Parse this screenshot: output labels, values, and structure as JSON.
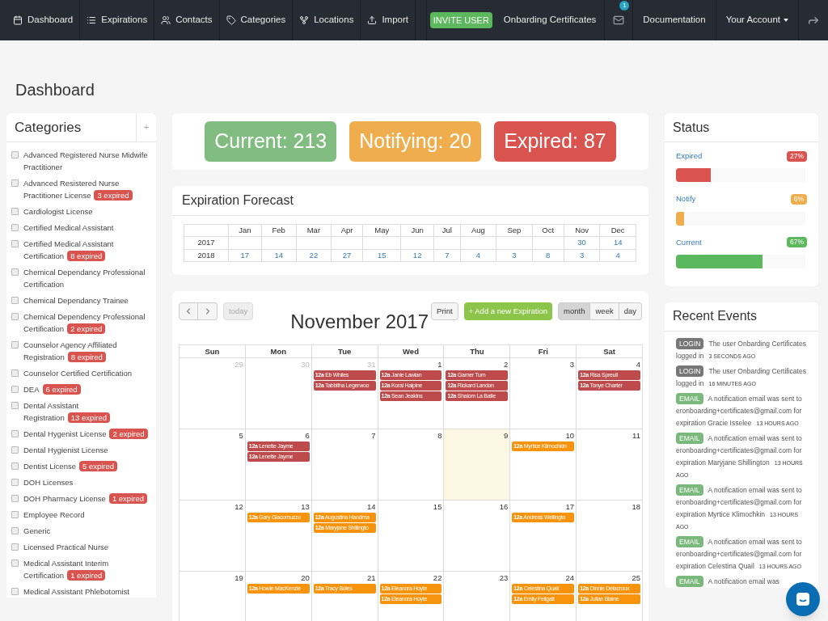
{
  "nav": {
    "items": [
      {
        "label": "Dashboard"
      },
      {
        "label": "Expirations"
      },
      {
        "label": "Contacts"
      },
      {
        "label": "Categories"
      },
      {
        "label": "Locations"
      },
      {
        "label": "Import"
      }
    ],
    "invite": "INVITE USER",
    "user": "Onbarding Certificates",
    "mail_count": "1",
    "documentation": "Documentation",
    "account": "Your Account"
  },
  "page_title": "Dashboard",
  "categories": {
    "title": "Categories",
    "add": "+",
    "items": [
      {
        "label": "Advanced Registered Nurse Midwife Practitioner",
        "checked": false
      },
      {
        "label": "Advanced Resistered Nurse Practitioner License",
        "badge": "3 expired",
        "checked": false
      },
      {
        "label": "Cardiologist License",
        "checked": false
      },
      {
        "label": "Certified Medical Assistant",
        "checked": false
      },
      {
        "label": "Certified Medical Assistant Certification",
        "badge": "8 expired",
        "checked": false
      },
      {
        "label": "Chemical Dependancy Professional Certification",
        "checked": false
      },
      {
        "label": "Chemical Dependancy Trainee",
        "checked": false
      },
      {
        "label": "Chemical Dependency Professional Certification",
        "badge": "2 expired",
        "checked": false
      },
      {
        "label": "Counselor Agency Affiliated Registration",
        "badge": "8 expired",
        "checked": false
      },
      {
        "label": "Counselor Certified Certification",
        "checked": false
      },
      {
        "label": "DEA",
        "badge": "6 expired",
        "checked": false
      },
      {
        "label": "Dental Assistant Registration",
        "badge": "13 expired",
        "checked": false
      },
      {
        "label": "Dental Hygenist License",
        "badge": "2 expired",
        "checked": false
      },
      {
        "label": "Dental Hygienist License",
        "checked": false
      },
      {
        "label": "Dentist License",
        "badge": "5 expired",
        "checked": false
      },
      {
        "label": "DOH Licenses",
        "checked": false
      },
      {
        "label": "DOH Pharmacy License",
        "badge": "1 expired",
        "checked": false
      },
      {
        "label": "Employee Record",
        "checked": false
      },
      {
        "label": "Generic",
        "checked": false
      },
      {
        "label": "Licensed Practical Nurse",
        "checked": false
      },
      {
        "label": "Medical Assistant Interim Certification",
        "badge": "1 expired",
        "checked": false
      },
      {
        "label": "Medical Assistant Phlebotomist",
        "checked": false
      }
    ]
  },
  "summary": [
    {
      "kind": "current",
      "label": "Current: 213"
    },
    {
      "kind": "notifying",
      "label": "Notifying: 20"
    },
    {
      "kind": "expired",
      "label": "Expired: 87"
    }
  ],
  "forecast": {
    "title": "Expiration Forecast",
    "months": [
      "Jan",
      "Feb",
      "Mar",
      "Apr",
      "May",
      "Jun",
      "Jul",
      "Aug",
      "Sep",
      "Oct",
      "Nov",
      "Dec"
    ],
    "rows": [
      {
        "year": "2017",
        "cells": [
          null,
          null,
          null,
          null,
          null,
          null,
          null,
          null,
          null,
          null,
          "30",
          "14"
        ]
      },
      {
        "year": "2018",
        "cells": [
          "17",
          "14",
          "22",
          "27",
          "15",
          "12",
          "7",
          "4",
          "3",
          "8",
          "3",
          "4"
        ]
      }
    ]
  },
  "calendar": {
    "title": "November 2017",
    "today_button": "today",
    "print": "Print",
    "add": "+ Add a new Expiration",
    "views": [
      {
        "label": "month",
        "selected": true
      },
      {
        "label": "week",
        "selected": false
      },
      {
        "label": "day",
        "selected": false
      }
    ],
    "weekdays": [
      "Sun",
      "Mon",
      "Tue",
      "Wed",
      "Thu",
      "Fri",
      "Sat"
    ],
    "weeks": [
      [
        {
          "day": "29",
          "other_month": true,
          "today": false
        },
        {
          "day": "30",
          "other_month": true,
          "today": false
        },
        {
          "day": "31",
          "other_month": true,
          "today": false,
          "events": [
            {
              "time": "12a",
              "name": "Eb Whiles",
              "color": "#bd4b4b"
            },
            {
              "time": "12a",
              "name": "Tabbitha Legerwoo",
              "color": "#bd4b4b"
            }
          ]
        },
        {
          "day": "1",
          "other_month": false,
          "today": false,
          "events": [
            {
              "time": "12a",
              "name": "Janie Lawlan",
              "color": "#bd4b4b"
            },
            {
              "time": "12a",
              "name": "Koral Halpine",
              "color": "#bd4b4b"
            },
            {
              "time": "12a",
              "name": "Sean Jeakins",
              "color": "#bd4b4b"
            }
          ]
        },
        {
          "day": "2",
          "other_month": false,
          "today": false,
          "events": [
            {
              "time": "12a",
              "name": "Garner Turn",
              "color": "#bd4b4b"
            },
            {
              "time": "12a",
              "name": "Rickard Landon",
              "color": "#bd4b4b"
            },
            {
              "time": "12a",
              "name": "Shalom La Batie",
              "color": "#bd4b4b"
            }
          ]
        },
        {
          "day": "3",
          "other_month": false,
          "today": false
        },
        {
          "day": "4",
          "other_month": false,
          "today": false,
          "events": [
            {
              "time": "12a",
              "name": "Risa Spreull",
              "color": "#bd4b4b"
            },
            {
              "time": "12a",
              "name": "Tonye Charter",
              "color": "#bd4b4b"
            }
          ]
        }
      ],
      [
        {
          "day": "5",
          "other_month": false,
          "today": false
        },
        {
          "day": "6",
          "other_month": false,
          "today": false,
          "events": [
            {
              "time": "12a",
              "name": "Lenette Jayme",
              "color": "#bd4b4b"
            },
            {
              "time": "12a",
              "name": "Lenette Jayme",
              "color": "#bd4b4b"
            }
          ]
        },
        {
          "day": "7",
          "other_month": false,
          "today": false
        },
        {
          "day": "8",
          "other_month": false,
          "today": false
        },
        {
          "day": "9",
          "other_month": false,
          "today": true
        },
        {
          "day": "10",
          "other_month": false,
          "today": false,
          "events": [
            {
              "time": "12a",
              "name": "Myrtice Klimochkin",
              "color": "#f8930d"
            }
          ]
        },
        {
          "day": "11",
          "other_month": false,
          "today": false
        }
      ],
      [
        {
          "day": "12",
          "other_month": false,
          "today": false
        },
        {
          "day": "13",
          "other_month": false,
          "today": false,
          "events": [
            {
              "time": "12a",
              "name": "Gary Giacomuzzo",
              "color": "#f8930d"
            }
          ]
        },
        {
          "day": "14",
          "other_month": false,
          "today": false,
          "events": [
            {
              "time": "12a",
              "name": "Augustina Handma",
              "color": "#f8930d"
            },
            {
              "time": "12a",
              "name": "Maryjane Shillingto",
              "color": "#f8930d"
            }
          ]
        },
        {
          "day": "15",
          "other_month": false,
          "today": false
        },
        {
          "day": "16",
          "other_month": false,
          "today": false
        },
        {
          "day": "17",
          "other_month": false,
          "today": false,
          "events": [
            {
              "time": "12a",
              "name": "Andreas Wellingto",
              "color": "#f8930d"
            }
          ]
        },
        {
          "day": "18",
          "other_month": false,
          "today": false
        }
      ],
      [
        {
          "day": "19",
          "other_month": false,
          "today": false
        },
        {
          "day": "20",
          "other_month": false,
          "today": false,
          "events": [
            {
              "time": "12a",
              "name": "Howie MacKenzie",
              "color": "#f8930d"
            }
          ]
        },
        {
          "day": "21",
          "other_month": false,
          "today": false,
          "events": [
            {
              "time": "12a",
              "name": "Tracy Boles",
              "color": "#f8930d"
            }
          ]
        },
        {
          "day": "22",
          "other_month": false,
          "today": false,
          "events": [
            {
              "time": "12a",
              "name": "Eleanora Hoyte",
              "color": "#f8930d"
            },
            {
              "time": "12a",
              "name": "Eleanora Hoyte",
              "color": "#f8930d"
            }
          ]
        },
        {
          "day": "23",
          "other_month": false,
          "today": false
        },
        {
          "day": "24",
          "other_month": false,
          "today": false,
          "events": [
            {
              "time": "12a",
              "name": "Celestina Quail",
              "color": "#f8930d"
            },
            {
              "time": "12a",
              "name": "Emily Fellgatt",
              "color": "#f8930d"
            }
          ]
        },
        {
          "day": "25",
          "other_month": false,
          "today": false,
          "events": [
            {
              "time": "12a",
              "name": "Dinnie Delacroux",
              "color": "#f8930d"
            },
            {
              "time": "12a",
              "name": "Julian Blaine",
              "color": "#f8930d"
            }
          ]
        }
      ]
    ]
  },
  "status": {
    "title": "Status",
    "items": [
      {
        "label": "Expired",
        "percent": "27%",
        "level": 0.27,
        "color": "#d9534f"
      },
      {
        "label": "Notify",
        "percent": "6%",
        "level": 0.06,
        "color": "#f0ad4e"
      },
      {
        "label": "Current",
        "percent": "67%",
        "level": 0.67,
        "color": "#5cb85c"
      }
    ]
  },
  "recent": {
    "title": "Recent Events",
    "items": [
      {
        "kind": "login",
        "tag": "LOGIN",
        "text": "The user Onbarding Certificates logged in",
        "time": "3 SECONDS AGO"
      },
      {
        "kind": "login",
        "tag": "LOGIN",
        "text": "The user Onbarding Certificates logged in",
        "time": "16 MINUTES AGO"
      },
      {
        "kind": "email",
        "tag": "EMAIL",
        "text": "A notification email was sent to eronboarding+certificates@gmail.com for expiration Gracie Isselee",
        "time": "13 HOURS AGO"
      },
      {
        "kind": "email",
        "tag": "EMAIL",
        "text": "A notification email was sent to eronboarding+certificates@gmail.com for expiration Maryjane Shillington",
        "time": "13 HOURS AGO"
      },
      {
        "kind": "email",
        "tag": "EMAIL",
        "text": "A notification email was sent to eronboarding+certificates@gmail.com for expiration Myrtice Klimochkin",
        "time": "13 HOURS AGO"
      },
      {
        "kind": "email",
        "tag": "EMAIL",
        "text": "A notification email was sent to eronboarding+certificates@gmail.com for expiration Celestina Quail",
        "time": "13 HOURS AGO"
      },
      {
        "kind": "email",
        "tag": "EMAIL",
        "text": "A notification email was"
      }
    ]
  }
}
